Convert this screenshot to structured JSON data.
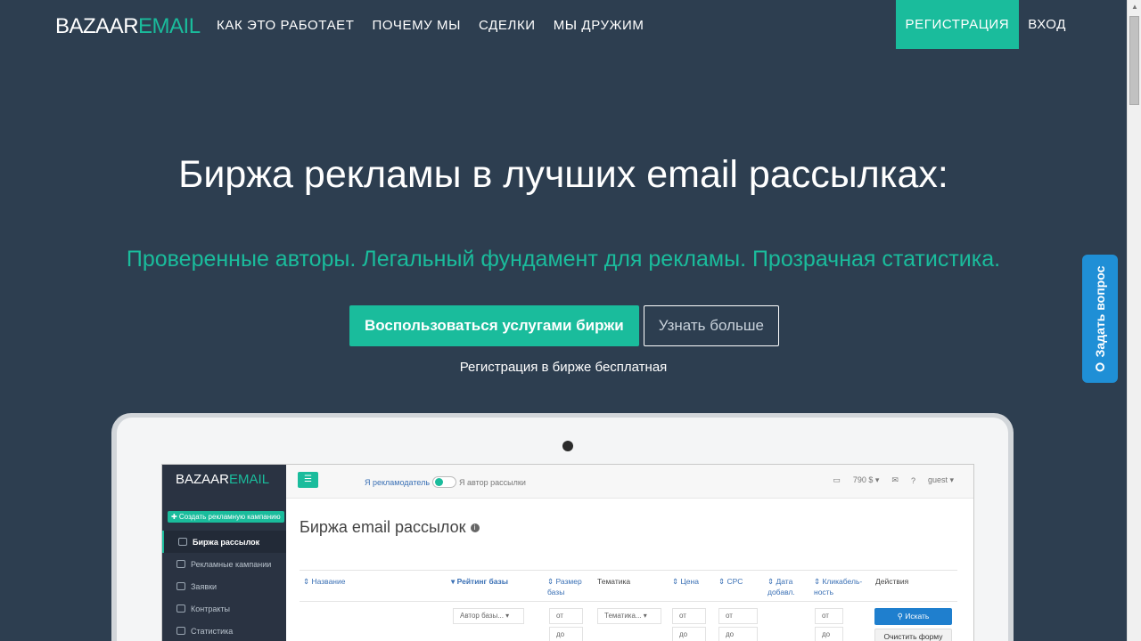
{
  "nav": {
    "logo_part1": "BAZAAR",
    "logo_part2": "EMAIL",
    "links": [
      "КАК ЭТО РАБОТАЕТ",
      "ПОЧЕМУ МЫ",
      "СДЕЛКИ",
      "МЫ ДРУЖИМ"
    ],
    "register": "РЕГИСТРАЦИЯ",
    "login": "ВХОД"
  },
  "hero": {
    "title": "Биржа рекламы в лучших email рассылках:",
    "subtitle": "Проверенные авторы. Легальный фундамент для рекламы. Прозрачная статистика.",
    "primary_button": "Воспользоваться услугами биржи",
    "secondary_button": "Узнать больше",
    "note": "Регистрация в бирже бесплатная"
  },
  "ask_tab": {
    "label": "Задать вопрос",
    "icon": "chat-bubble-icon"
  },
  "colors": {
    "background": "#2d3e50",
    "accent": "#1abc9c",
    "ask_tab": "#1f8fd6"
  },
  "app": {
    "logo_part1": "BAZAAR",
    "logo_part2": "EMAIL",
    "create_button": "✚ Создать рекламную кампанию",
    "menu": [
      {
        "label": "Биржа рассылок",
        "icon": "star-icon"
      },
      {
        "label": "Рекламные кампании",
        "icon": "briefcase-icon"
      },
      {
        "label": "Заявки",
        "icon": "paper-plane-icon"
      },
      {
        "label": "Контракты",
        "icon": "bank-icon"
      },
      {
        "label": "Статистика",
        "icon": "chart-icon"
      }
    ],
    "role_left": "Я рекламодатель",
    "role_right": "Я автор рассылки",
    "balance": "790 $ ▾",
    "help": "?",
    "user": "guest ▾",
    "page_title": "Биржа email рассылок",
    "columns": [
      "⇕ Название",
      "▾ Рейтинг базы",
      "⇕ Размер базы",
      "Тематика",
      "⇕ Цена",
      "⇕ CPC",
      "⇕ Дата добавл.",
      "⇕ Кликабель-ность",
      "Действия"
    ],
    "filters": {
      "rating_select": "Автор базы...  ▾",
      "from": "от",
      "to": "до",
      "topic_select": "Тематика...  ▾",
      "search_button": "Искать",
      "clear_button": "Очистить форму"
    }
  }
}
